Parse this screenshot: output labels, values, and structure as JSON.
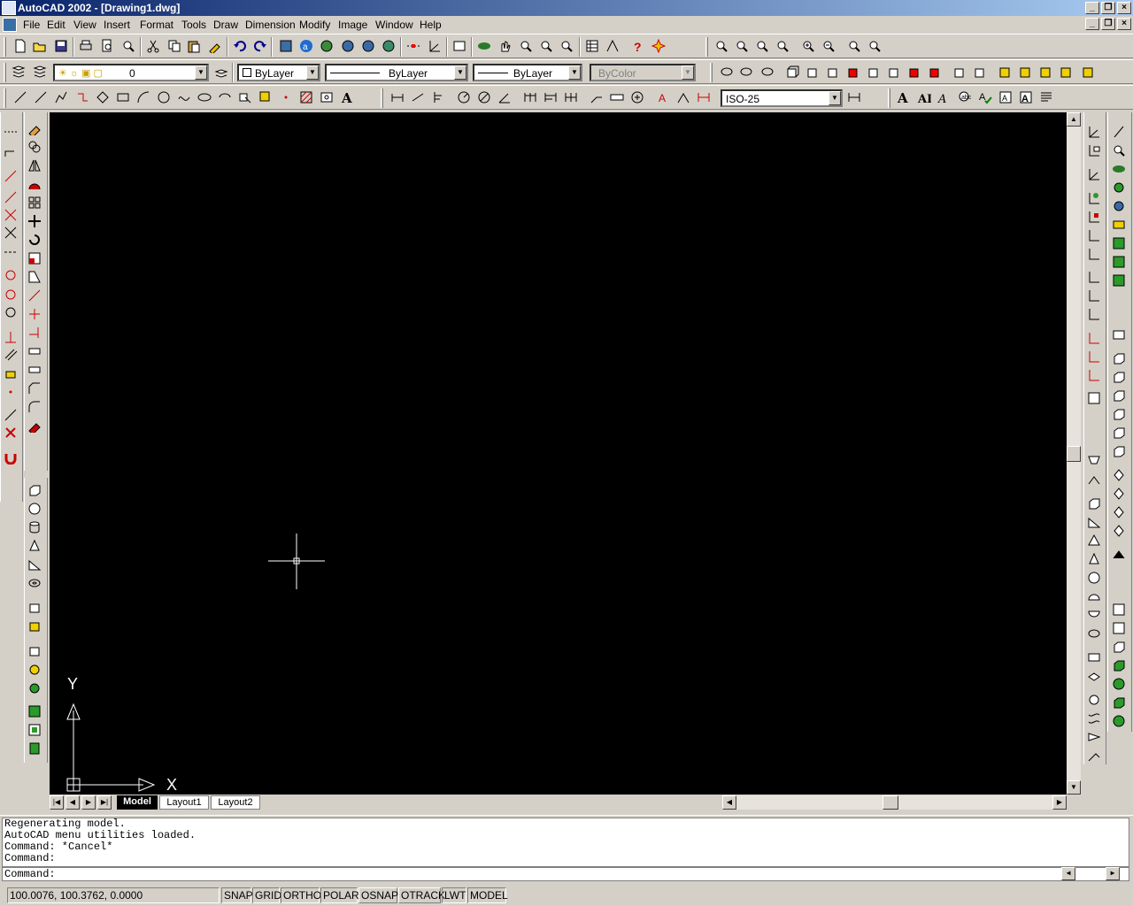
{
  "window": {
    "title": "AutoCAD 2002 - [Drawing1.dwg]"
  },
  "menu": [
    "File",
    "Edit",
    "View",
    "Insert",
    "Format",
    "Tools",
    "Draw",
    "Dimension",
    "Modify",
    "Image",
    "Window",
    "Help"
  ],
  "window_buttons": {
    "minimize": "_",
    "restore": "❐",
    "close": "×"
  },
  "properties": {
    "layer": "0",
    "color": "ByLayer",
    "linetype": "ByLayer",
    "lineweight": "ByLayer",
    "plotstyle": "ByColor"
  },
  "dimstyle": "ISO-25",
  "tabs": [
    "Model",
    "Layout1",
    "Layout2"
  ],
  "active_tab": "Model",
  "ucs": {
    "x_label": "X",
    "y_label": "Y"
  },
  "command_history": [
    "Regenerating model.",
    "AutoCAD menu utilities loaded.",
    "Command: *Cancel*",
    "Command:"
  ],
  "command_prompt": "Command:",
  "status": {
    "coords": "100.0076, 100.3762, 0.0000",
    "toggles": [
      "SNAP",
      "GRID",
      "ORTHO",
      "POLAR",
      "OSNAP",
      "OTRACK",
      "LWT",
      "MODEL"
    ]
  },
  "colors": {
    "canvas": "#000000",
    "chrome": "#d4d0c8",
    "title_start": "#0a246a",
    "title_end": "#a6caf0"
  }
}
